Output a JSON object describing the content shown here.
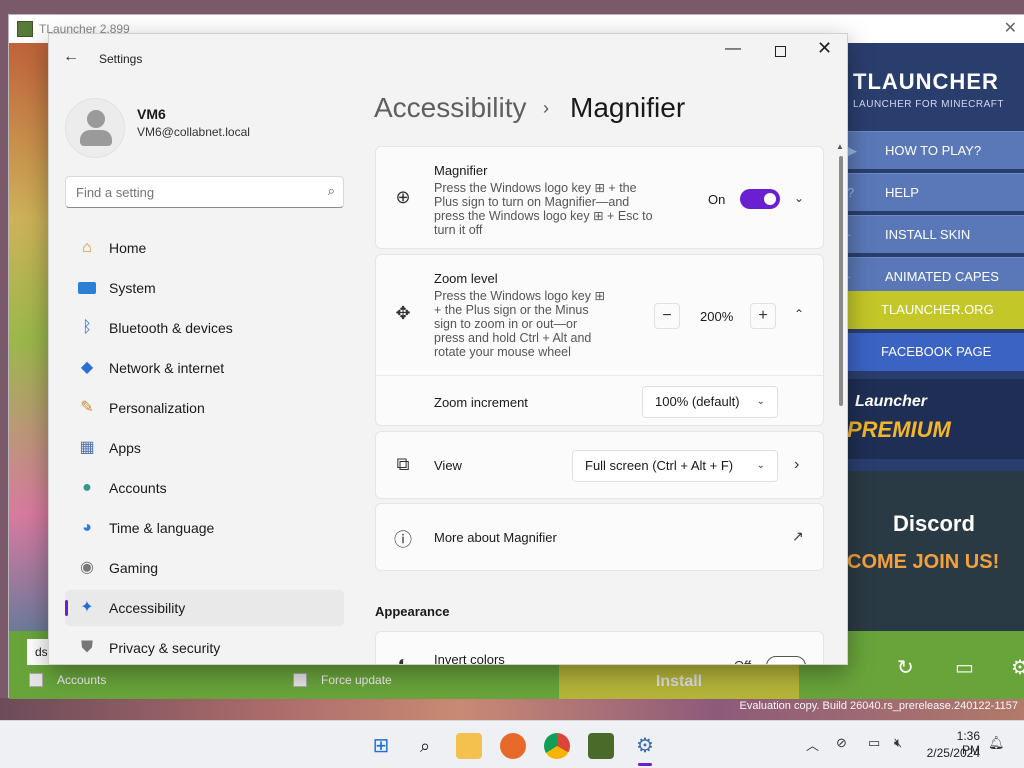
{
  "launcher": {
    "title": "TLauncher 2.899",
    "brand": "TLAUNCHER",
    "brand_sub": "LAUNCHER FOR MINECRAFT",
    "nav": [
      "HOW TO PLAY?",
      "HELP",
      "INSTALL SKIN",
      "ANIMATED CAPES"
    ],
    "org_link": "TLAUNCHER.ORG",
    "fb_link": "FACEBOOK PAGE",
    "premium_line1": "Launcher",
    "premium_line2": "PREMIUM",
    "discord_title": "Discord",
    "discord_sub": "COME JOIN US!",
    "username_value": "ds",
    "accounts_label": "Accounts",
    "force_update_label": "Force update",
    "install_label": "Install"
  },
  "settings": {
    "window_title": "Settings",
    "profile": {
      "name": "VM6",
      "email": "VM6@collabnet.local"
    },
    "search_placeholder": "Find a setting",
    "nav": [
      {
        "label": "Home",
        "icon": "home-icon"
      },
      {
        "label": "System",
        "icon": "system-icon"
      },
      {
        "label": "Bluetooth & devices",
        "icon": "bluetooth-icon"
      },
      {
        "label": "Network & internet",
        "icon": "wifi-icon"
      },
      {
        "label": "Personalization",
        "icon": "brush-icon"
      },
      {
        "label": "Apps",
        "icon": "apps-icon"
      },
      {
        "label": "Accounts",
        "icon": "accounts-icon"
      },
      {
        "label": "Time & language",
        "icon": "globe-clock-icon"
      },
      {
        "label": "Gaming",
        "icon": "gamepad-icon"
      },
      {
        "label": "Accessibility",
        "icon": "accessibility-icon",
        "active": true
      },
      {
        "label": "Privacy & security",
        "icon": "shield-icon"
      }
    ],
    "breadcrumb": {
      "parent": "Accessibility",
      "current": "Magnifier"
    },
    "magnifier": {
      "title": "Magnifier",
      "desc": [
        "Press the Windows logo key ⊞ + the",
        "Plus sign to turn on Magnifier—and",
        "press the Windows logo key ⊞ + Esc to",
        "turn it off"
      ],
      "state": "On"
    },
    "zoom": {
      "title": "Zoom level",
      "desc": [
        "Press the Windows logo key ⊞",
        "+ the Plus sign or the Minus",
        "sign to zoom in or out—or",
        "press and hold Ctrl + Alt and",
        "rotate your mouse wheel"
      ],
      "value": "200%",
      "increment_label": "Zoom increment",
      "increment_value": "100% (default)"
    },
    "view": {
      "label": "View",
      "value": "Full screen (Ctrl + Alt + F)"
    },
    "more": {
      "label": "More about Magnifier"
    },
    "appearance_header": "Appearance",
    "invert": {
      "label": "Invert colors",
      "state": "Off"
    },
    "accent_color": "#6a1fd1"
  },
  "watermark": "Evaluation copy. Build 26040.rs_prerelease.240122-1157",
  "taskbar": {
    "time": "1:36 PM",
    "date": "2/25/2024"
  }
}
